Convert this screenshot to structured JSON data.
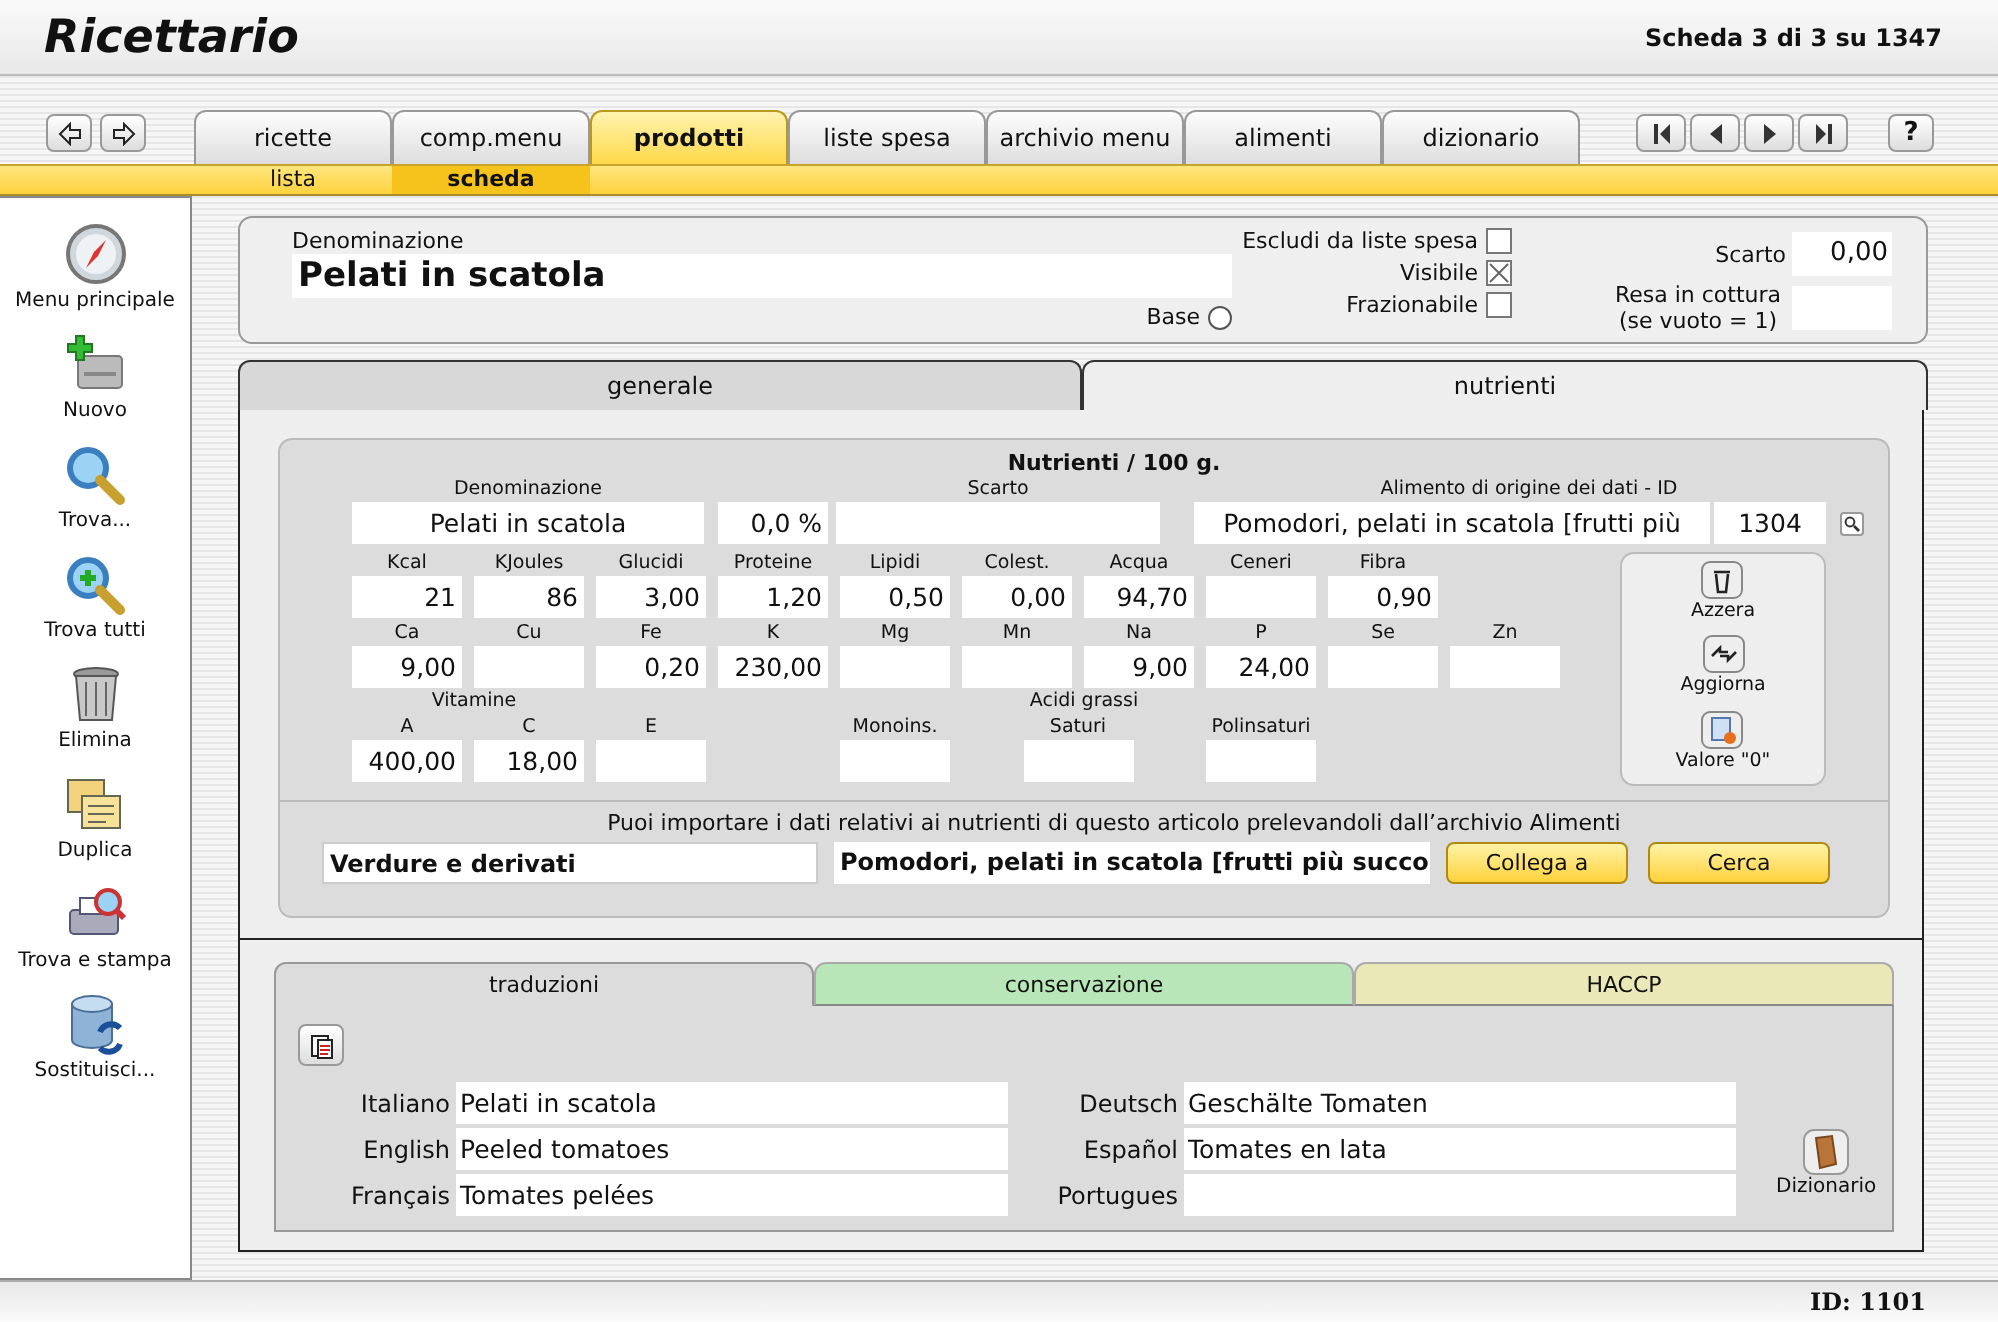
{
  "app": {
    "title": "Ricettario",
    "record": "Scheda 3 di 3 su 1347",
    "help": "?"
  },
  "nav_tabs": [
    {
      "label": "ricette",
      "selected": false
    },
    {
      "label": "comp.menu",
      "selected": false
    },
    {
      "label": "prodotti",
      "selected": true
    },
    {
      "label": "liste spesa",
      "selected": false
    },
    {
      "label": "archivio menu",
      "selected": false
    },
    {
      "label": "alimenti",
      "selected": false
    },
    {
      "label": "dizionario",
      "selected": false
    }
  ],
  "sub_tabs": [
    {
      "label": "lista",
      "selected": false
    },
    {
      "label": "scheda",
      "selected": true
    }
  ],
  "sidebar": {
    "items": [
      {
        "label": "Menu principale",
        "kind": "compass"
      },
      {
        "label": "Nuovo",
        "kind": "new"
      },
      {
        "label": "Trova...",
        "kind": "find"
      },
      {
        "label": "Trova tutti",
        "kind": "findall"
      },
      {
        "label": "Elimina",
        "kind": "trash"
      },
      {
        "label": "Duplica",
        "kind": "copy"
      },
      {
        "label": "Trova e stampa",
        "kind": "print"
      },
      {
        "label": "Sostituisci...",
        "kind": "database"
      }
    ]
  },
  "product": {
    "name_label": "Denominazione",
    "name": "Pelati in scatola",
    "base": {
      "label": "Base",
      "checked": false
    },
    "flags": [
      {
        "label": "Escludi da liste spesa",
        "checked": false
      },
      {
        "label": "Visibile",
        "checked": true
      },
      {
        "label": "Frazionabile",
        "checked": false
      }
    ],
    "scarto": {
      "label": "Scarto",
      "value": "0,00"
    },
    "resa": {
      "label": "Resa in cottura (se vuoto = 1)"
    }
  },
  "detail_tabs": [
    {
      "label": "generale",
      "selected": false
    },
    {
      "label": "nutrienti",
      "selected": true
    }
  ],
  "nutrients": {
    "title": "Nutrienti / 100 g.",
    "name_label": "Denominazione",
    "name": "Pelati in scatola",
    "scarto_pct": "0,0 %",
    "scarto_label": "Scarto",
    "source_label": "Alimento di origine dei dati - ID",
    "source": "Pomodori, pelati in scatola [frutti più",
    "source_id": "1304",
    "row_1": [
      {
        "label": "Kcal",
        "value": "21"
      },
      {
        "label": "KJoules",
        "value": "86"
      },
      {
        "label": "Glucidi",
        "value": "3,00"
      },
      {
        "label": "Proteine",
        "value": "1,20"
      },
      {
        "label": "Lipidi",
        "value": "0,50"
      },
      {
        "label": "Colest.",
        "value": "0,00"
      },
      {
        "label": "Acqua",
        "value": "94,70"
      },
      {
        "label": "Ceneri"
      },
      {
        "label": "Fibra",
        "value": "0,90"
      }
    ],
    "row_2": [
      {
        "label": "Ca",
        "value": "9,00"
      },
      {
        "label": "Cu"
      },
      {
        "label": "Fe",
        "value": "0,20"
      },
      {
        "label": "K",
        "value": "230,00"
      },
      {
        "label": "Mg"
      },
      {
        "label": "Mn"
      },
      {
        "label": "Na",
        "value": "9,00"
      },
      {
        "label": "P",
        "value": "24,00"
      },
      {
        "label": "Se"
      },
      {
        "label": "Zn"
      }
    ],
    "vitamins_label": "Vitamine",
    "fatty_acids_label": "Acidi grassi",
    "row_3": [
      {
        "label": "A",
        "value": "400,00"
      },
      {
        "label": "C",
        "value": "18,00"
      },
      {
        "label": "E"
      },
      {
        "label": "Monoins."
      },
      {
        "label": "Saturi"
      },
      {
        "label": "Polinsaturi"
      }
    ],
    "actions": [
      {
        "label": "Azzera",
        "kind": "trash"
      },
      {
        "label": "Aggiorna",
        "kind": "swap"
      },
      {
        "label": "Valore \"0\"",
        "kind": "zero"
      }
    ]
  },
  "import": {
    "text": "Puoi importare i dati relativi ai nutrienti di questo articolo prelevandoli dall’archivio Alimenti",
    "category": "Verdure e derivati",
    "food": "Pomodori, pelati in scatola [frutti più succo",
    "buttons": [
      "Collega a",
      "Cerca"
    ]
  },
  "lower_tabs": [
    {
      "label": "traduzioni",
      "selected": true,
      "color": "#dcdcdc"
    },
    {
      "label": "conservazione",
      "selected": false,
      "color": "#b9e6b9"
    },
    {
      "label": "HACCP",
      "selected": false,
      "color": "#ebe8b8"
    }
  ],
  "translations": [
    {
      "language": "Italiano",
      "value": "Pelati in scatola"
    },
    {
      "language": "English",
      "value": "Peeled tomatoes"
    },
    {
      "language": "Français",
      "value": "Tomates pelées"
    },
    {
      "language": "Deutsch",
      "value": "Geschälte Tomaten"
    },
    {
      "language": "Español",
      "value": "Tomates en lata"
    },
    {
      "language": "Portugues"
    }
  ],
  "dictionary": {
    "label": "Dizionario"
  },
  "footer": {
    "id": "ID: 1101"
  }
}
